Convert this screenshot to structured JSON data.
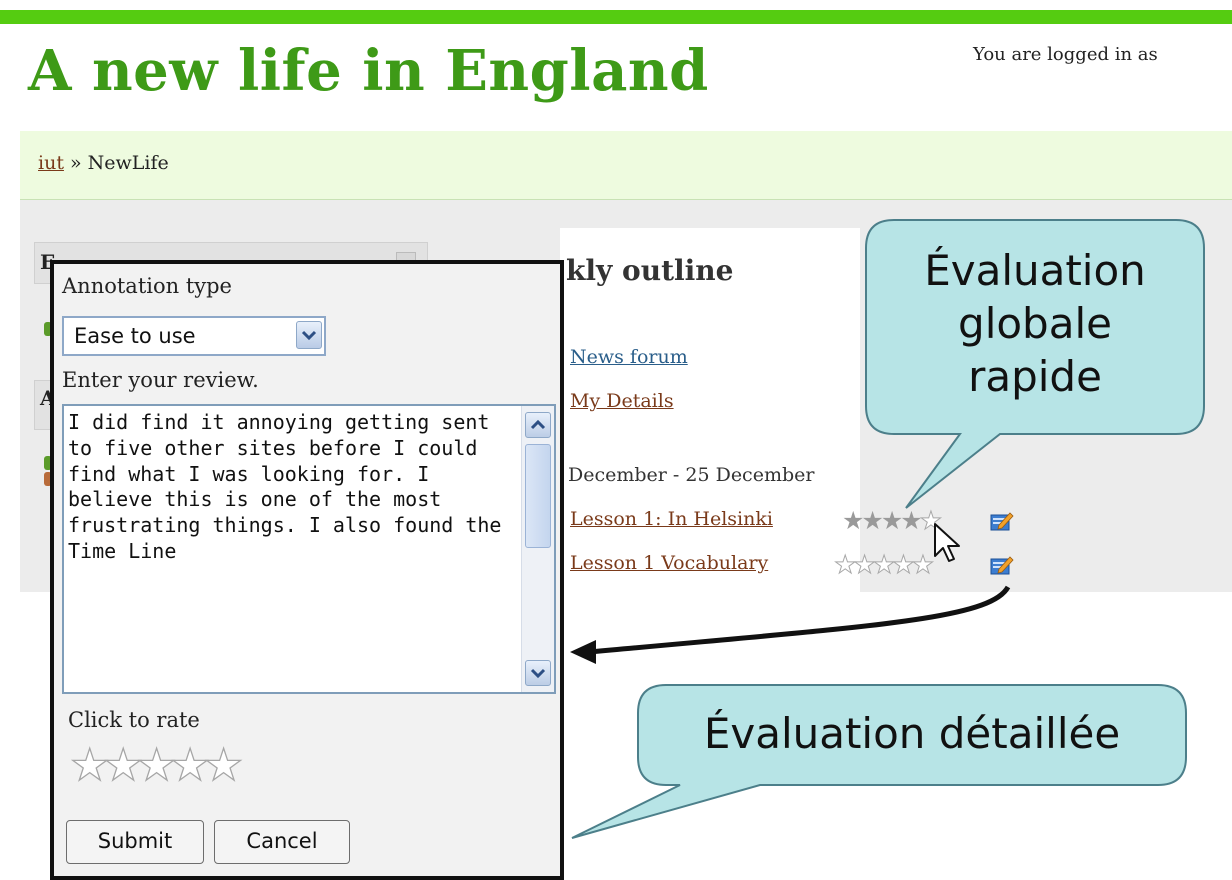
{
  "header": {
    "site_title": "A new life in England",
    "login_text": "You are logged in as"
  },
  "breadcrumb": {
    "home": "iut",
    "separator": "»",
    "current": "NewLife"
  },
  "course": {
    "section_title_partial": "kly outline",
    "links": [
      "News forum",
      "My Details"
    ],
    "week_text": "December - 25 December",
    "lessons": [
      {
        "label": "Lesson 1: In Helsinki",
        "rating_filled": 4,
        "rating_max": 5
      },
      {
        "label": "Lesson 1 Vocabulary",
        "rating_filled": 0,
        "rating_max": 5
      }
    ],
    "left_block_initials": [
      "E",
      "A"
    ]
  },
  "dialog": {
    "annotation_type_label": "Annotation type",
    "annotation_type_value": "Ease to use",
    "review_label": "Enter your review.",
    "review_text": "I did find it annoying getting sent to five other sites before I could find what I was looking for. I believe this is one of the most frustrating things. I also found the Time Line",
    "rate_label": "Click to rate",
    "rating_value": 0,
    "rating_max": 5,
    "submit_label": "Submit",
    "cancel_label": "Cancel"
  },
  "callouts": {
    "quick": "Évaluation\nglobale\nrapide",
    "detailed": "Évaluation détaillée",
    "fill_color": "#b7e4e6",
    "border_color": "#4c7f8a"
  },
  "colors": {
    "top_bar": "#55cc11",
    "title_green": "#3e9a17",
    "link_brown": "#7a3a1a"
  }
}
